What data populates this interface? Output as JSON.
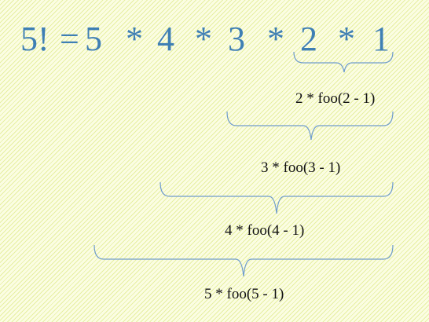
{
  "equation": {
    "lhs": "5!",
    "equals": "=",
    "terms": [
      "5",
      "*",
      "4",
      "*",
      "3",
      "*",
      "2",
      "*",
      "1"
    ]
  },
  "calls": [
    "2 * foo(2 - 1)",
    "3 * foo(3 - 1)",
    "4 * foo(4 - 1)",
    "5 * foo(5 - 1)"
  ],
  "colors": {
    "equation_text": "#3f7fb4",
    "brace_stroke": "#6f9ccc",
    "label_text": "#111111",
    "background": "#fbfde3",
    "stripe": "#e6efa1"
  }
}
